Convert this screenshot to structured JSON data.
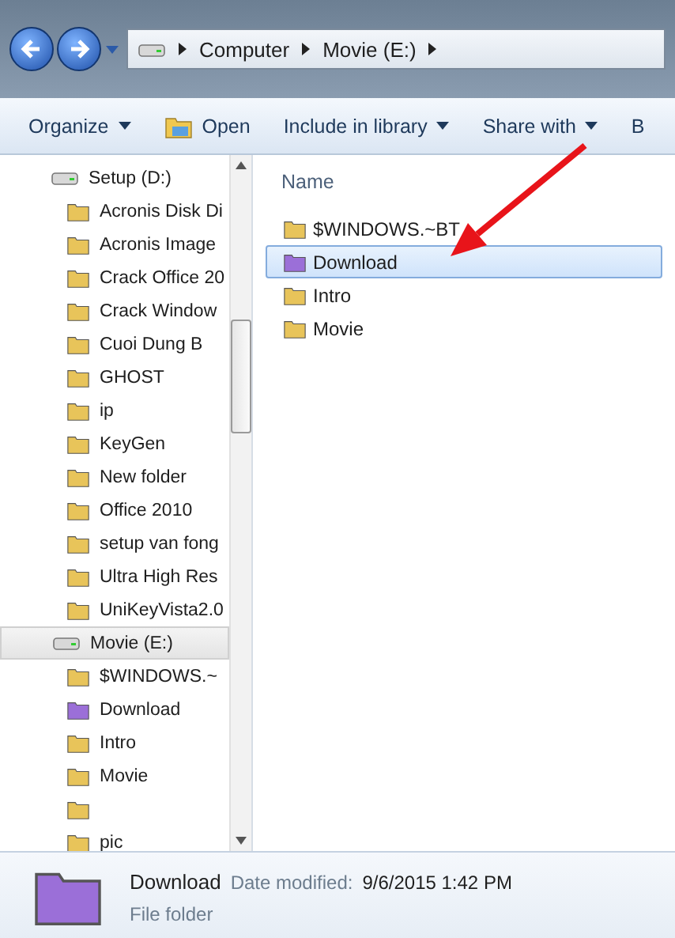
{
  "address_bar": {
    "segments": [
      "Computer",
      "Movie  (E:)"
    ]
  },
  "toolbar": {
    "buttons": [
      {
        "label": "Organize",
        "kind": "menu"
      },
      {
        "label": "Open",
        "kind": "open"
      },
      {
        "label": "Include in library",
        "kind": "menu"
      },
      {
        "label": "Share with",
        "kind": "menu"
      },
      {
        "label": "B",
        "kind": "plain"
      }
    ]
  },
  "navigation": {
    "items": [
      {
        "name": "Setup (D:)",
        "kind": "drive",
        "selected": false,
        "children": [
          {
            "name": "Acronis Disk Di",
            "color": "#e8c45a"
          },
          {
            "name": "Acronis Image",
            "color": "#e8c45a"
          },
          {
            "name": "Crack Office 20",
            "color": "#e8c45a"
          },
          {
            "name": "Crack Window",
            "color": "#e8c45a"
          },
          {
            "name": "Cuoi Dung B",
            "color": "#e8c45a"
          },
          {
            "name": "GHOST",
            "color": "#e8c45a"
          },
          {
            "name": "ip",
            "color": "#e8c45a"
          },
          {
            "name": "KeyGen",
            "color": "#e8c45a"
          },
          {
            "name": "New folder",
            "color": "#e8c45a"
          },
          {
            "name": "Office 2010",
            "color": "#e8c45a"
          },
          {
            "name": "setup van fong",
            "color": "#e8c45a"
          },
          {
            "name": "Ultra High Res",
            "color": "#e8c45a"
          },
          {
            "name": "UniKeyVista2.0",
            "color": "#e8c45a"
          }
        ]
      },
      {
        "name": "Movie  (E:)",
        "kind": "drive",
        "selected": true,
        "children": [
          {
            "name": "$WINDOWS.~",
            "color": "#e8c45a"
          },
          {
            "name": "Download",
            "color": "#9b6fd8"
          },
          {
            "name": "Intro",
            "color": "#e8c45a"
          },
          {
            "name": "Movie",
            "color": "#e8c45a"
          },
          {
            "color": "#e8c45a"
          },
          {
            "name": "pic",
            "color": "#e8c45a"
          }
        ]
      }
    ]
  },
  "file_list": {
    "column": "Name",
    "items": [
      {
        "name": "$WINDOWS.~BT",
        "color": "#e8c45a",
        "selected": false
      },
      {
        "name": "Download",
        "color": "#9b6fd8",
        "selected": true
      },
      {
        "name": "Intro",
        "color": "#e8c45a",
        "selected": false
      },
      {
        "name": "Movie",
        "color": "#e8c45a",
        "selected": false
      }
    ]
  },
  "details": {
    "name": "Download",
    "color": "#9b6fd8",
    "date_label": "Date modified:",
    "date": "9/6/2015 1:42 PM",
    "type": "File folder"
  }
}
